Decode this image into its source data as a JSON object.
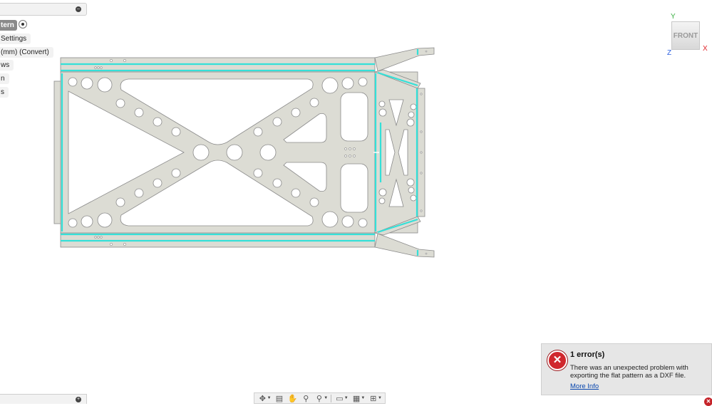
{
  "browser": {
    "rows": [
      {
        "label": "tern",
        "active": true
      },
      {
        "label": " Settings",
        "active": false
      },
      {
        "label": " (mm) (Convert)",
        "active": false
      },
      {
        "label": "ws",
        "active": false
      },
      {
        "label": "n",
        "active": false
      },
      {
        "label": "s",
        "active": false
      }
    ]
  },
  "viewcube": {
    "face": "FRONT",
    "axis_y": "Y",
    "axis_x": "X",
    "axis_z": "Z"
  },
  "colors": {
    "part_fill": "#dcdcd4",
    "part_edge": "#8a8a8a",
    "bend_line": "#34e0d8",
    "error_red": "#d0272d"
  },
  "error": {
    "title": "1 error(s)",
    "message": "There was an unexpected problem with exporting the flat pattern as a DXF file.",
    "link": "More Info"
  },
  "toolbar": {
    "tools": [
      "orbit-icon",
      "look-at-icon",
      "pan-icon",
      "zoom-icon",
      "fit-icon",
      "display-settings-icon",
      "grid-settings-icon",
      "viewports-icon"
    ]
  }
}
